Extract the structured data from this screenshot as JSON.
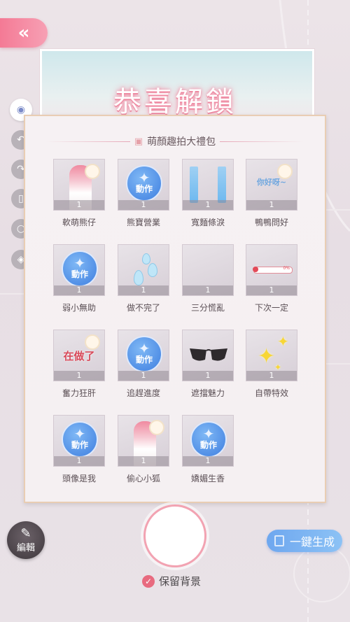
{
  "back_button": {
    "icon": "double-chevron-left-icon",
    "glyph": "«"
  },
  "banner": {
    "title": "恭喜解鎖"
  },
  "side_tools": [
    {
      "name": "eye-icon",
      "glyph": "◉"
    },
    {
      "name": "undo-icon",
      "glyph": "↶"
    },
    {
      "name": "redo-icon",
      "glyph": "↷"
    },
    {
      "name": "trash-icon",
      "glyph": "▯"
    },
    {
      "name": "zoom-icon",
      "glyph": "○"
    },
    {
      "name": "layers-icon",
      "glyph": "◈"
    }
  ],
  "panel": {
    "title": "萌顏趣拍大禮包",
    "items": [
      {
        "name": "軟萌熊仔",
        "count": "1",
        "kind": "avatar"
      },
      {
        "name": "熊寶營業",
        "count": "1",
        "kind": "action",
        "badge": "動作"
      },
      {
        "name": "寬麵條淚",
        "count": "1",
        "kind": "tears"
      },
      {
        "name": "鴨鴨問好",
        "count": "1",
        "kind": "word",
        "art": "你好呀~"
      },
      {
        "name": "弱小無助",
        "count": "1",
        "kind": "action",
        "badge": "動作"
      },
      {
        "name": "做不完了",
        "count": "1",
        "kind": "drops"
      },
      {
        "name": "三分慌亂",
        "count": "1",
        "kind": "blank"
      },
      {
        "name": "下次一定",
        "count": "1",
        "kind": "bar",
        "pct": "0%"
      },
      {
        "name": "奮力狂肝",
        "count": "1",
        "kind": "word-red",
        "art": "在做了"
      },
      {
        "name": "追趕進度",
        "count": "1",
        "kind": "action",
        "badge": "動作"
      },
      {
        "name": "遮擋魅力",
        "count": "1",
        "kind": "glasses"
      },
      {
        "name": "自帶特效",
        "count": "1",
        "kind": "sparkle"
      },
      {
        "name": "頭像是我",
        "count": "1",
        "kind": "action",
        "badge": "動作"
      },
      {
        "name": "偷心小狐",
        "count": "1",
        "kind": "avatar"
      },
      {
        "name": "嬌媚生香",
        "count": "1",
        "kind": "action",
        "badge": "動作"
      }
    ]
  },
  "edit_button": {
    "label": "編輯"
  },
  "generate_button": {
    "label": "一鍵生成"
  },
  "keep_background": {
    "label": "保留背景",
    "checked": true
  }
}
